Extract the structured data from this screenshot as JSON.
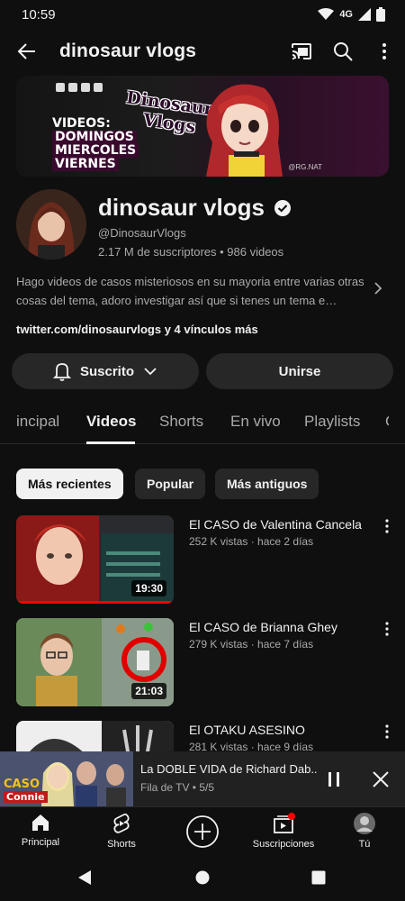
{
  "status_bar": {
    "time": "10:59",
    "network": "4G"
  },
  "header": {
    "query": "dinosaur vlogs"
  },
  "banner": {
    "schedule_title": "VIDEOS:",
    "days": [
      "DOMINGOS",
      "MIERCOLES",
      "VIERNES"
    ],
    "logo_line1": "Dinosaur",
    "logo_line2": "Vlogs",
    "credit": "@RG.NAT"
  },
  "channel": {
    "name": "dinosaur vlogs",
    "handle": "@DinosaurVlogs",
    "stats": "2.17 M de suscriptores • 986 videos",
    "description": "Hago videos de casos misteriosos en su mayoria entre varias otras cosas del tema, adoro investigar así que si tenes un tema e…",
    "links": "twitter.com/dinosaurvlogs y 4 vínculos más",
    "subscribe_label": "Suscrito",
    "join_label": "Unirse"
  },
  "tabs": [
    "incipal",
    "Videos",
    "Shorts",
    "En vivo",
    "Playlists"
  ],
  "chips": [
    "Más recientes",
    "Popular",
    "Más antiguos"
  ],
  "videos": [
    {
      "title": "El CASO de Valentina Cancela",
      "meta": "252 K vistas · hace 2 días",
      "duration": "19:30",
      "watched": 1.0
    },
    {
      "title": "El CASO de Brianna Ghey",
      "meta": "279 K vistas · hace 7 días",
      "duration": "21:03",
      "watched": 0
    },
    {
      "title": "El OTAKU ASESINO",
      "meta": "281 K vistas · hace 9 días",
      "duration": "",
      "watched": 0
    }
  ],
  "mini_player": {
    "title": "La DOBLE VIDA de Richard Dab..",
    "subtitle": "Fila de TV • 5/5",
    "thumb_text1": "CASO",
    "thumb_text2": "Connie"
  },
  "bottom_nav": [
    "Principal",
    "Shorts",
    "Suscripciones",
    "Tú"
  ],
  "colors": {
    "background": "#0f0f0f",
    "surface": "#272727",
    "accent_red": "#ff0000",
    "text": "#f1f1f1",
    "muted": "#aaaaaa"
  }
}
